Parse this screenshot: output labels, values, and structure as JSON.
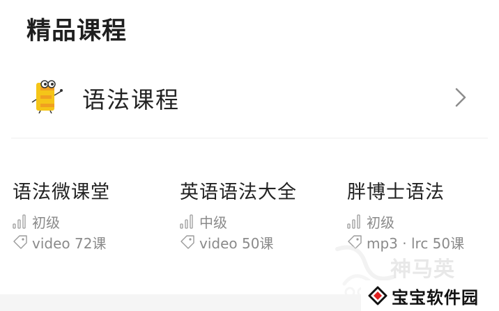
{
  "section": {
    "title": "精品课程"
  },
  "category": {
    "label": "语法课程",
    "icon": "e-mascot-icon",
    "chevron": "chevron-right-icon"
  },
  "courses": [
    {
      "title": "语法微课堂",
      "level": "初级",
      "media": "video 72课"
    },
    {
      "title": "英语语法大全",
      "level": "中级",
      "media": "video 50课"
    },
    {
      "title": "胖博士语法",
      "level": "初级",
      "media": "mp3 · lrc 50课"
    }
  ],
  "watermark": {
    "ghost_text": "神马英",
    "site_name": "宝宝软件园"
  },
  "colors": {
    "mascot_yellow": "#f5c518",
    "mascot_orange": "#f0a020",
    "meta_gray": "#8a8a8a",
    "logo_red": "#e02020"
  }
}
